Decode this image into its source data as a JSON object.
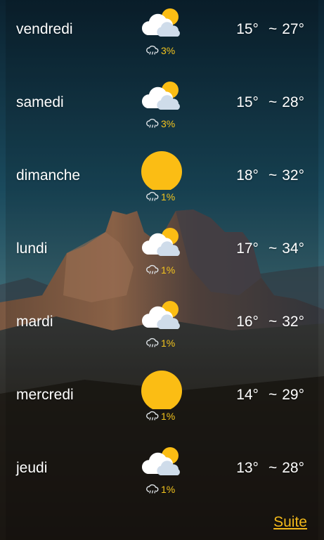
{
  "forecast": [
    {
      "day": "vendredi",
      "icon": "partly-cloudy-icon",
      "precip": "3%",
      "low": "15°",
      "high": "27°"
    },
    {
      "day": "samedi",
      "icon": "partly-cloudy-icon",
      "precip": "3%",
      "low": "15°",
      "high": "28°"
    },
    {
      "day": "dimanche",
      "icon": "sun-icon",
      "precip": "1%",
      "low": "18°",
      "high": "32°"
    },
    {
      "day": "lundi",
      "icon": "partly-cloudy-icon",
      "precip": "1%",
      "low": "17°",
      "high": "34°"
    },
    {
      "day": "mardi",
      "icon": "partly-cloudy-icon",
      "precip": "1%",
      "low": "16°",
      "high": "32°"
    },
    {
      "day": "mercredi",
      "icon": "sun-icon",
      "precip": "1%",
      "low": "14°",
      "high": "29°"
    },
    {
      "day": "jeudi",
      "icon": "partly-cloudy-icon",
      "precip": "1%",
      "low": "13°",
      "high": "28°"
    }
  ],
  "temp_separator": "~",
  "more_link": "Suite",
  "colors": {
    "precip_text": "#f3c41e",
    "link": "#f2b81a",
    "sun": "#fbbd14"
  }
}
